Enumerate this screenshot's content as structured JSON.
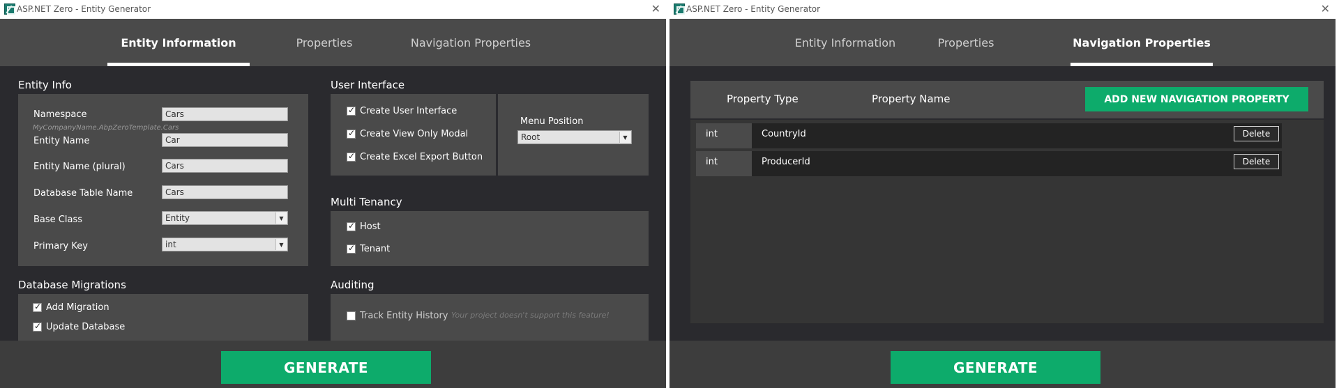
{
  "window_title": "ASP.NET Zero - Entity Generator",
  "close_glyph": "✕",
  "tabs": [
    "Entity Information",
    "Properties",
    "Navigation Properties"
  ],
  "entity_info": {
    "title": "Entity Info",
    "namespace_label": "Namespace",
    "namespace_value": "Cars",
    "namespace_hint": "MyCompanyName.AbpZeroTemplate.Cars",
    "entity_name_label": "Entity Name",
    "entity_name_value": "Car",
    "entity_plural_label": "Entity Name (plural)",
    "entity_plural_value": "Cars",
    "table_label": "Database Table Name",
    "table_value": "Cars",
    "base_class_label": "Base Class",
    "base_class_value": "Entity",
    "primary_key_label": "Primary Key",
    "primary_key_value": "int"
  },
  "user_interface": {
    "title": "User Interface",
    "create_ui": {
      "label": "Create User Interface",
      "checked": true
    },
    "view_only_modal": {
      "label": "Create View Only Modal",
      "checked": true
    },
    "excel_export": {
      "label": "Create Excel Export Button",
      "checked": true
    },
    "menu_position_label": "Menu Position",
    "menu_position_value": "Root"
  },
  "multi_tenancy": {
    "title": "Multi Tenancy",
    "host": {
      "label": "Host",
      "checked": true
    },
    "tenant": {
      "label": "Tenant",
      "checked": true
    }
  },
  "db_migrations": {
    "title": "Database Migrations",
    "add_migration": {
      "label": "Add Migration",
      "checked": true
    },
    "update_database": {
      "label": "Update Database",
      "checked": true
    }
  },
  "auditing": {
    "title": "Auditing",
    "track_history": {
      "label": "Track Entity History",
      "checked": false
    },
    "unsupported_note": "Your project doesn't support this feature!"
  },
  "navigation": {
    "col_type": "Property Type",
    "col_name": "Property Name",
    "add_button": "ADD NEW NAVIGATION PROPERTY",
    "delete_label": "Delete",
    "rows": [
      {
        "type": "int",
        "name": "CountryId"
      },
      {
        "type": "int",
        "name": "ProducerId"
      }
    ]
  },
  "generate_button": "GENERATE",
  "colors": {
    "accent_green": "#0dab6b",
    "panel": "#4a4a4a",
    "body": "#2a2a2e"
  }
}
